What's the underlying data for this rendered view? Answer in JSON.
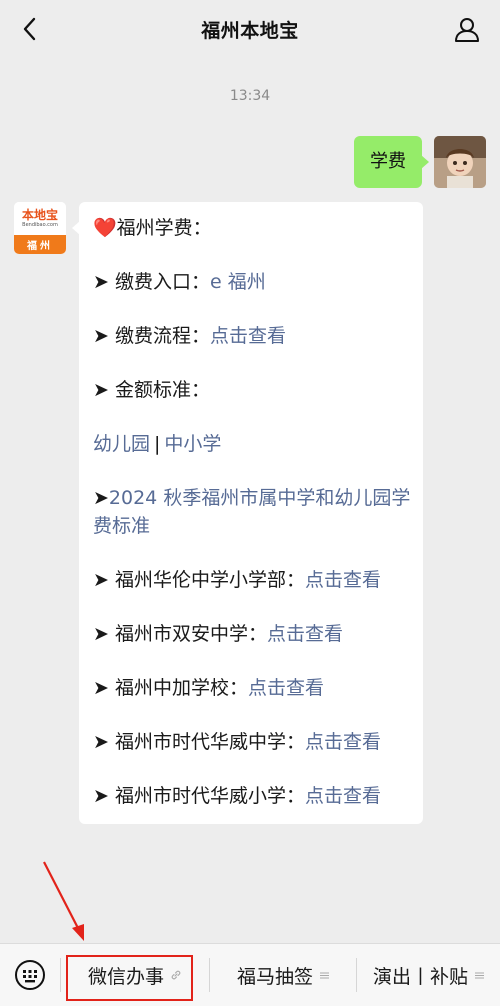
{
  "header": {
    "title": "福州本地宝",
    "back_icon": "chevron-left-icon",
    "profile_icon": "person-icon"
  },
  "time": "13:34",
  "outgoing": {
    "text": "学费"
  },
  "incoming": {
    "avatar": {
      "logo_text": "本地宝",
      "logo_url": "Bendibao.com",
      "city": "福州"
    },
    "lines": [
      {
        "prefix": "",
        "text": "福州学费：",
        "link": ""
      },
      {
        "prefix": "➤ ",
        "text": "缴费入口：",
        "link": "e 福州"
      },
      {
        "prefix": "➤ ",
        "text": "缴费流程：",
        "link": "点击查看"
      },
      {
        "prefix": "➤ ",
        "text": "金额标准：",
        "link": ""
      },
      {
        "prefix": "",
        "text": "",
        "link": ""
      },
      {
        "prefix": "➤",
        "text": "",
        "link": "2024 秋季福州市属中学和幼儿园学费标准"
      },
      {
        "prefix": "➤ ",
        "text": "福州华伦中学小学部：",
        "link": "点击查看"
      },
      {
        "prefix": "➤ ",
        "text": "福州市双安中学：",
        "link": "点击查看"
      },
      {
        "prefix": "➤ ",
        "text": "福州中加学校：",
        "link": "点击查看"
      },
      {
        "prefix": "➤ ",
        "text": "福州市时代华威中学：",
        "link": "点击查看"
      },
      {
        "prefix": "➤ ",
        "text": "福州市时代华威小学：",
        "link": "点击查看"
      }
    ],
    "kindergarten_link": "幼儿园",
    "school_link": "中小学",
    "separator": "|"
  },
  "bottom_menu": {
    "keyboard_icon": "keyboard-icon",
    "items": [
      {
        "label": "微信办事",
        "suffix_icon": "link-icon"
      },
      {
        "label": "福马抽签",
        "suffix_icon": "menu-lines-icon"
      },
      {
        "label": "演出丨补贴",
        "suffix_icon": "menu-lines-icon"
      }
    ]
  },
  "colors": {
    "background": "#ededed",
    "outgoing_bubble": "#95ec69",
    "link": "#576b95",
    "annotation_red": "#e2231a"
  }
}
